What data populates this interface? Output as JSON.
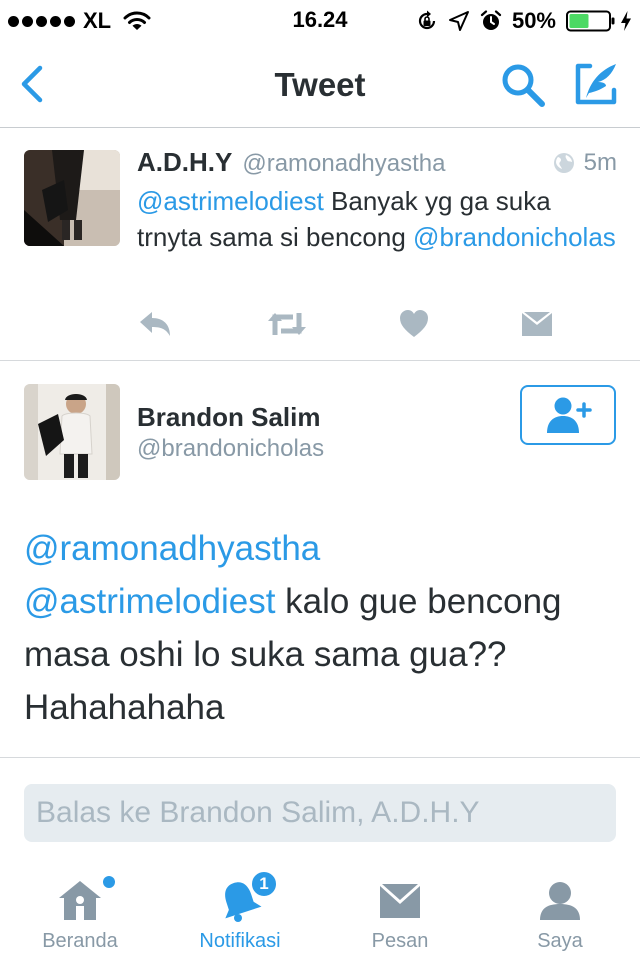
{
  "status_bar": {
    "carrier": "XL",
    "time": "16.24",
    "battery_percent": "50%",
    "battery_level": 0.5,
    "icons": [
      "signal-dots-icon",
      "wifi-icon",
      "rotation-lock-icon",
      "location-arrow-icon",
      "alarm-icon",
      "battery-icon",
      "charging-bolt-icon"
    ]
  },
  "nav": {
    "title": "Tweet",
    "back_icon": "chevron-left-icon",
    "search_icon": "search-icon",
    "compose_icon": "compose-icon"
  },
  "parent_tweet": {
    "name": "A.D.H.Y",
    "handle": "@ramonadhyastha",
    "time": "5m",
    "text": {
      "mention1": "@astrimelodiest",
      "body": " Banyak yg ga suka trnyta sama si bencong ",
      "mention2": "@brandonicholas"
    },
    "actions": [
      "reply-icon",
      "retweet-icon",
      "like-icon",
      "message-icon"
    ]
  },
  "main_tweet": {
    "name": "Brandon Salim",
    "handle": "@brandonicholas",
    "follow_icon": "follow-user-icon",
    "text": {
      "mention1": "@ramonadhyastha",
      "mention2": "@astrimelodiest",
      "body": " kalo gue bencong masa oshi lo suka sama gua?? Hahahahaha"
    }
  },
  "reply": {
    "placeholder": "Balas ke Brandon Salim, A.D.H.Y",
    "value": ""
  },
  "tabs": [
    {
      "label": "Beranda",
      "icon": "home-icon",
      "active": false,
      "has_dot": true
    },
    {
      "label": "Notifikasi",
      "icon": "bell-icon",
      "active": true,
      "badge": "1"
    },
    {
      "label": "Pesan",
      "icon": "envelope-icon",
      "active": false
    },
    {
      "label": "Saya",
      "icon": "profile-icon",
      "active": false
    }
  ],
  "colors": {
    "accent": "#2b9ae6",
    "muted": "#8899a6",
    "text": "#292f33",
    "divider": "#d6d9dc",
    "battery_green": "#4cd964"
  }
}
